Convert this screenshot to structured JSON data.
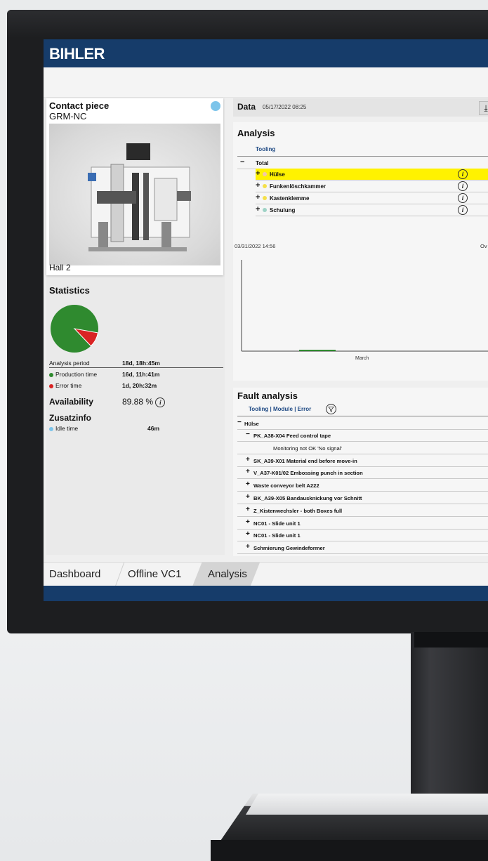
{
  "brand": "BIHLER",
  "card": {
    "title": "Contact piece",
    "subtitle": "GRM-NC",
    "location": "Hall 2",
    "status_color": "#7cc4ea"
  },
  "statistics": {
    "title": "Statistics",
    "pie": {
      "production_fraction": 0.8988,
      "production_color": "#2f8a2f",
      "error_color": "#d92323"
    },
    "rows": [
      {
        "label": "Analysis period",
        "value": "18d, 18h:45m"
      },
      {
        "label": "Production time",
        "value": "16d, 11h:41m",
        "color": "#2f8a2f"
      },
      {
        "label": "Error time",
        "value": "1d, 20h:32m",
        "color": "#d92323"
      }
    ],
    "availability_label": "Availability",
    "availability_value": "89.88 %",
    "zusatz_title": "Zusatzinfo",
    "zusatz_rows": [
      {
        "label": "Idle time",
        "value": "46m",
        "color": "#7cc4ea"
      }
    ]
  },
  "data_bar": {
    "title": "Data",
    "timestamp": "05/17/2022 08:25"
  },
  "analysis": {
    "title": "Analysis",
    "tab": "Tooling",
    "total_label": "Total",
    "items": [
      {
        "label": "Hülse",
        "color": "#f2c6a8",
        "highlight": true
      },
      {
        "label": "Funkenlöschkammer",
        "color": "#f5e04a",
        "highlight": false
      },
      {
        "label": "Kastenklemme",
        "color": "#f5e04a",
        "highlight": false
      },
      {
        "label": "Schulung",
        "color": "#9fd3c6",
        "highlight": false
      }
    ],
    "chart_start": "03/31/2022 14:56",
    "chart_right_label": "Ov",
    "chart_x_label": "March"
  },
  "fault_analysis": {
    "title": "Fault analysis",
    "tabs": "Tooling | Module | Error",
    "root": "Hülse",
    "rows": [
      {
        "sign": "−",
        "text": "PK_A38-X04 Feed control tape",
        "level": 1
      },
      {
        "sign": "",
        "text": "Monitoring not OK 'No signal'",
        "level": 2
      },
      {
        "sign": "+",
        "text": "SK_A39-X01 Material end before move-in",
        "level": 1
      },
      {
        "sign": "+",
        "text": "V_A37-K01/02 Embossing punch in section",
        "level": 1
      },
      {
        "sign": "+",
        "text": "Waste conveyor belt A222",
        "level": 1
      },
      {
        "sign": "+",
        "text": "BK_A39-X05 Bandausknickung vor Schnitt",
        "level": 1
      },
      {
        "sign": "+",
        "text": "Z_Kistenwechsler - both Boxes full",
        "level": 1
      },
      {
        "sign": "+",
        "text": "NC01 - Slide unit 1",
        "level": 1
      },
      {
        "sign": "+",
        "text": "NC01 - Slide unit 1",
        "level": 1
      },
      {
        "sign": "+",
        "text": "Schmierung Gewindeformer",
        "level": 1
      }
    ]
  },
  "bottom_tabs": [
    "Dashboard",
    "Offline VC1",
    "Analysis"
  ],
  "active_tab": "Analysis",
  "colors": {
    "header": "#163c6a",
    "highlight": "#fff200",
    "link": "#1f4a84"
  }
}
